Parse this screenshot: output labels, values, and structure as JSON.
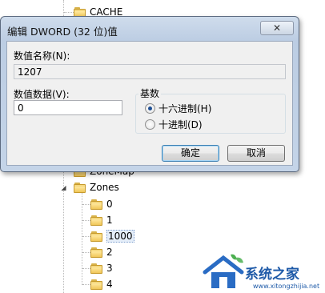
{
  "tree": {
    "top_node": "CACHE",
    "partial_node": "ZoneMap",
    "zones": "Zones",
    "children": [
      "0",
      "1",
      "1000",
      "2",
      "3",
      "4"
    ],
    "selected": "1000"
  },
  "dialog": {
    "title": "编辑 DWORD (32 位)值",
    "close_symbol": "✕",
    "name_label": "数值名称(N):",
    "name_value": "1207",
    "data_label": "数值数据(V):",
    "data_value": "0",
    "base_title": "基数",
    "radio_hex": "十六进制(H)",
    "radio_dec": "十进制(D)",
    "selected_base": "hex",
    "ok": "确定",
    "cancel": "取消"
  },
  "watermark": {
    "text": "系统之家",
    "url": "www.xitongzhijia.net"
  },
  "colors": {
    "title_gradient_top": "#cfdcec",
    "client_bg": "#f0f0f0",
    "watermark_blue": "#1e5aa8"
  }
}
